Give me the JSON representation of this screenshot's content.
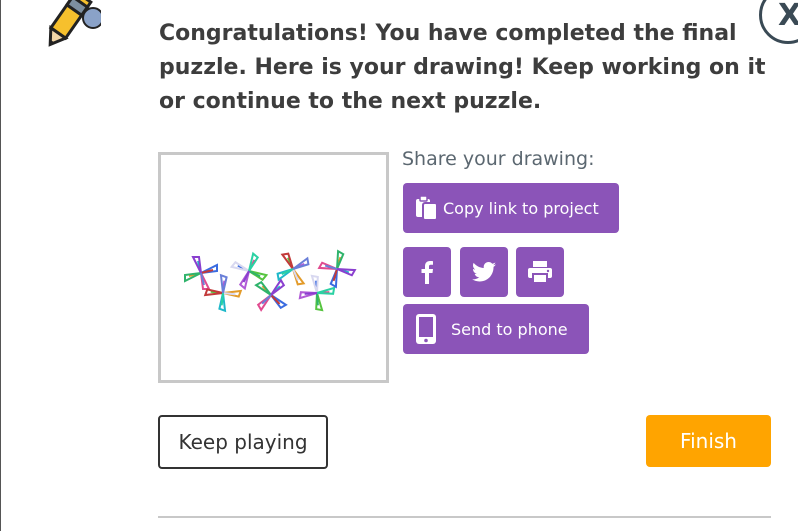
{
  "close_button": {
    "label": "X"
  },
  "message": "Congratulations! You have completed the final puzzle. Here is your drawing! Keep working on it or continue to the next puzzle.",
  "share": {
    "label": "Share your drawing:",
    "copy_link_label": "Copy link to project",
    "send_to_phone_label": "Send to phone",
    "icons": [
      "clipboard-icon",
      "facebook-icon",
      "twitter-icon",
      "printer-icon",
      "phone-icon"
    ]
  },
  "buttons": {
    "keep_playing": "Keep playing",
    "finish": "Finish"
  },
  "colors": {
    "accent_purple": "#8b54b8",
    "finish_orange": "#ffa400",
    "text_dark": "#3d3d3d",
    "frame_gray": "#c8c8c8"
  }
}
